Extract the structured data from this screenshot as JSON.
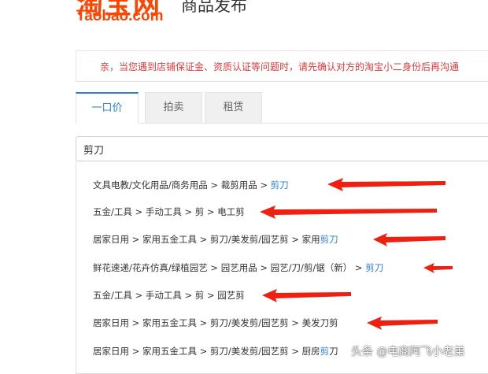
{
  "header": {
    "logo_cn": "淘宝网",
    "logo_en": "Taobao.com",
    "title": "商品发布"
  },
  "notice": "亲，当您遇到店铺保证金、资质认证等问题时，请先确认对方的淘宝小二身份后再沟通",
  "tabs": [
    {
      "label": "一口价",
      "active": true
    },
    {
      "label": "拍卖",
      "active": false
    },
    {
      "label": "租赁",
      "active": false
    }
  ],
  "search": {
    "value": "剪刀"
  },
  "results": [
    {
      "path": "文具电教/文化用品/商务用品 > 裁剪用品 > ",
      "match": "剪刀",
      "end": ""
    },
    {
      "path": "五金/工具 > 手动工具 > 剪 > 电工剪",
      "match": "",
      "end": ""
    },
    {
      "path": "居家日用 > 家用五金工具 > 剪刀/美发剪/园艺剪 > 家用",
      "match": "剪刀",
      "end": ""
    },
    {
      "path": "鲜花速递/花卉仿真/绿植园艺 > 园艺用品 > 园艺/刀/剪/锯（新） > ",
      "match": "剪刀",
      "end": ""
    },
    {
      "path": "五金/工具 > 手动工具 > 剪 > 园艺剪",
      "match": "",
      "end": ""
    },
    {
      "path": "居家日用 > 家用五金工具 > 剪刀/美发剪/园艺剪 > 美发刀剪",
      "match": "",
      "end": ""
    },
    {
      "path": "居家日用 > 家用五金工具 > 剪刀/美发剪/园艺剪 > 厨房",
      "match": "剪",
      "end": "刀"
    }
  ],
  "watermark": "头条 @电商阿飞小老弟",
  "colors": {
    "brand": "#ff4400",
    "link": "#2e7fd8",
    "notice": "#e4393c",
    "arrow": "#f02010"
  }
}
